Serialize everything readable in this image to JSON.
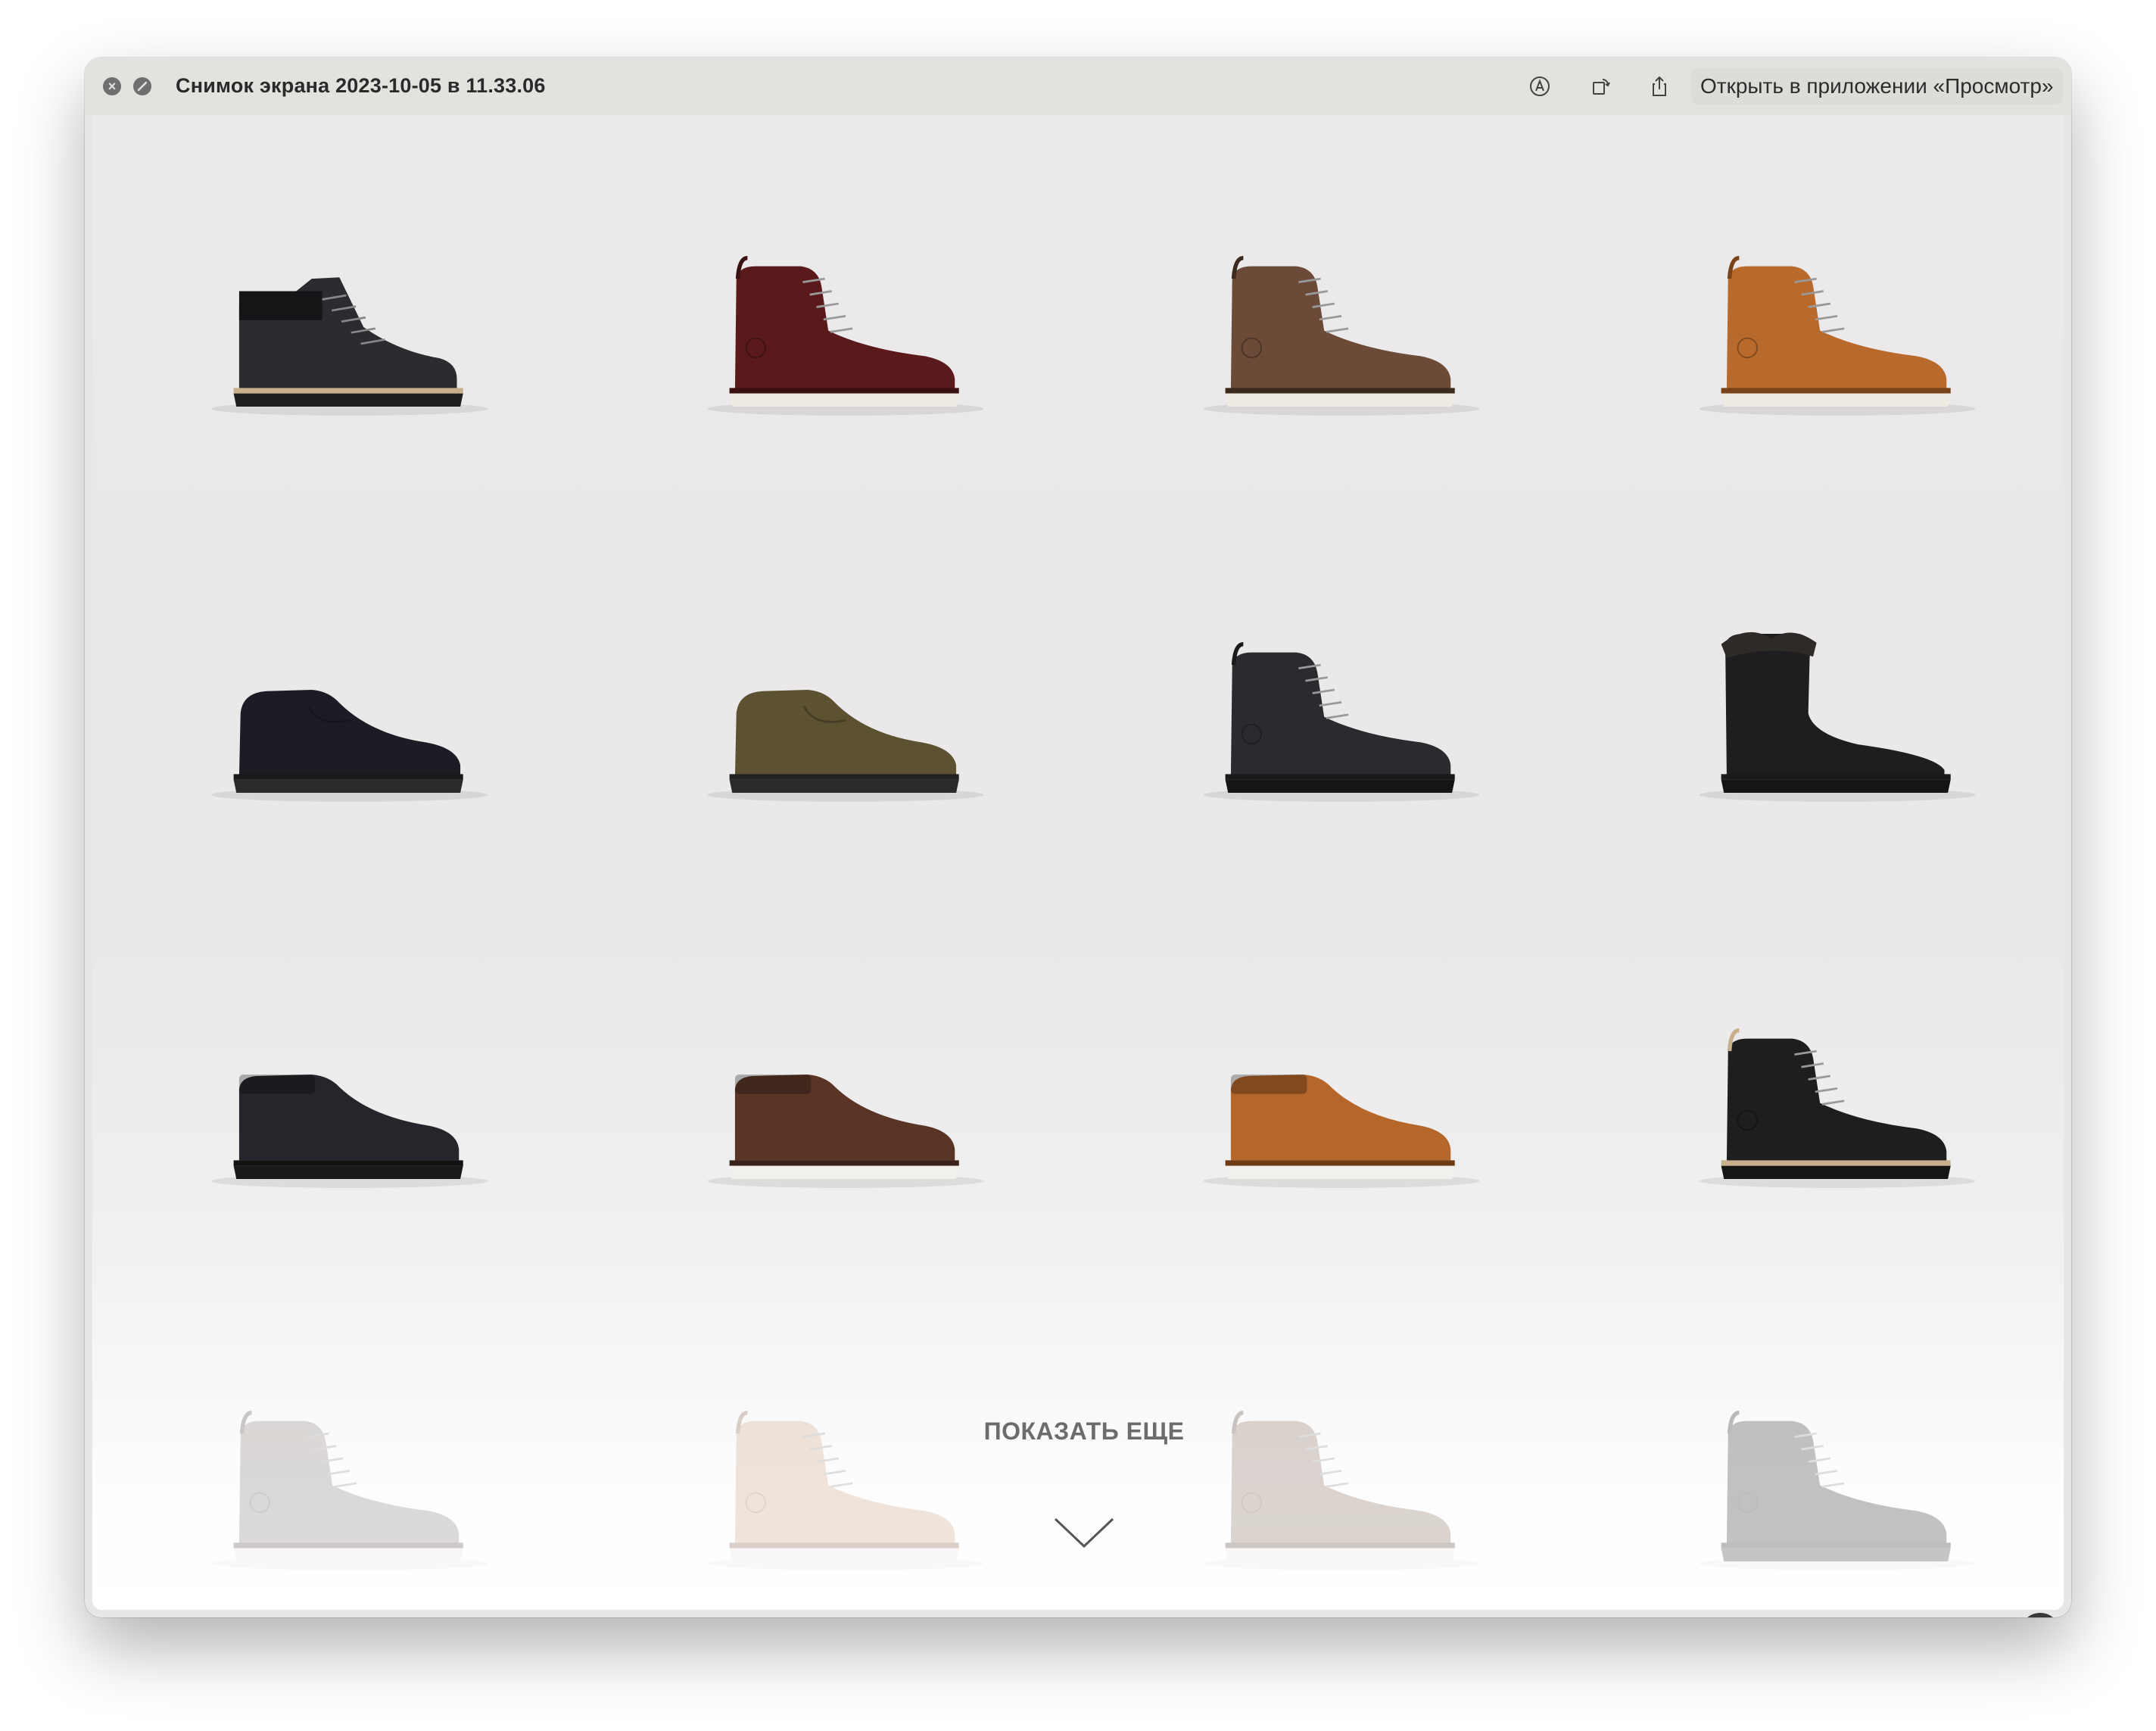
{
  "window": {
    "title": "Снимок экрана 2023-10-05 в 11.33.06",
    "open_in_app_label": "Открыть в приложении «Просмотр»"
  },
  "toolbar_icons": [
    "markup-icon",
    "rotate-icon",
    "share-icon"
  ],
  "catalog": {
    "show_more_label": "ПОКАЗАТЬ ЕЩЕ",
    "products": [
      {
        "name": "hiking-boot-black",
        "style": "hiker",
        "upper": "#2b2c2f",
        "sole": "#1e1e1e",
        "welt": "#c8b08a"
      },
      {
        "name": "work-boot-burgundy",
        "style": "work",
        "upper": "#5a1a1c",
        "sole": "#efebe3",
        "welt": "#3a1010"
      },
      {
        "name": "work-boot-brown",
        "style": "work",
        "upper": "#6b4a37",
        "sole": "#efebe3",
        "welt": "#3d2a1e"
      },
      {
        "name": "work-boot-tan",
        "style": "work",
        "upper": "#b86a2c",
        "sole": "#efebe3",
        "welt": "#7a4418"
      },
      {
        "name": "chukka-black-suede",
        "style": "chukka",
        "upper": "#1c1c24",
        "sole": "#2a2a2a",
        "welt": "#1a1a1a"
      },
      {
        "name": "chukka-olive-suede",
        "style": "chukka",
        "upper": "#5c5130",
        "sole": "#2a2a2a",
        "welt": "#222"
      },
      {
        "name": "lace-boot-black",
        "style": "work",
        "upper": "#2a2b2f",
        "sole": "#151515",
        "welt": "#1a1a1a"
      },
      {
        "name": "fur-boot-black",
        "style": "tall",
        "upper": "#1e1e20",
        "sole": "#151515",
        "welt": "#1a1a1a"
      },
      {
        "name": "sneaker-boot-black",
        "style": "sneaker",
        "upper": "#25262b",
        "sole": "#1a1a1a",
        "welt": "#111"
      },
      {
        "name": "sneaker-boot-brown",
        "style": "sneaker",
        "upper": "#5a3526",
        "sole": "#f2f0ec",
        "welt": "#3a2218"
      },
      {
        "name": "sneaker-boot-tan",
        "style": "sneaker",
        "upper": "#b5662a",
        "sole": "#f2f0ec",
        "welt": "#6d3c16"
      },
      {
        "name": "lace-boot-black-2",
        "style": "work",
        "upper": "#1e1e21",
        "sole": "#151515",
        "welt": "#c8b08a"
      },
      {
        "name": "lug-boot-grey",
        "style": "work",
        "upper": "#8f8883",
        "sole": "#ece8e1",
        "welt": "#5a534e"
      },
      {
        "name": "lug-boot-sand",
        "style": "work",
        "upper": "#d3a888",
        "sole": "#ece8e1",
        "welt": "#8a6a52"
      },
      {
        "name": "lug-boot-taupe",
        "style": "work",
        "upper": "#8c7566",
        "sole": "#ece8e1",
        "welt": "#5a4a40"
      },
      {
        "name": "lug-boot-dark",
        "style": "work",
        "upper": "#3b3b3e",
        "sole": "#444",
        "welt": "#2a2a2a"
      }
    ]
  }
}
